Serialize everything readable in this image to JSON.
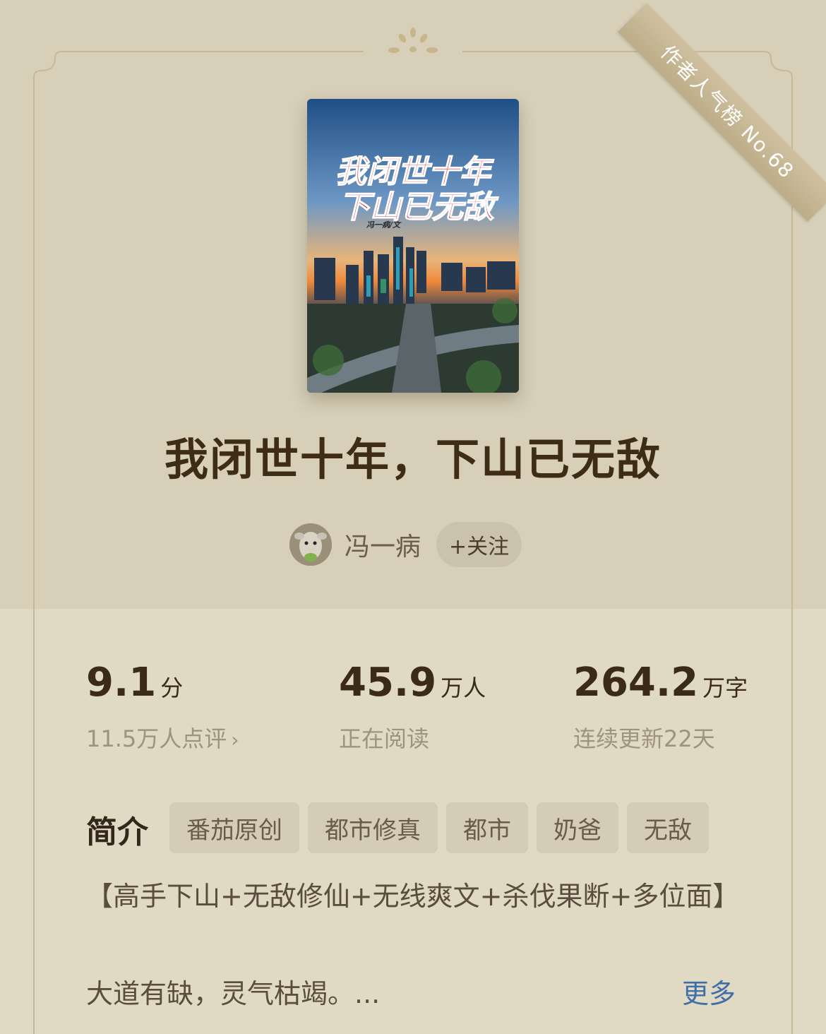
{
  "badge": {
    "label": "作者人气榜",
    "rank": "No.68"
  },
  "book": {
    "title": "我闭世十年，下山已无敌",
    "cover": {
      "title_line1": "我闭世十年",
      "title_line2": "下山已无敌",
      "byline": "冯一病/文"
    }
  },
  "author": {
    "name": "冯一病",
    "follow_label": "+关注"
  },
  "stats": [
    {
      "value": "9.1",
      "unit": "分",
      "sub": "11.5万人点评",
      "chevron": "›"
    },
    {
      "value": "45.9",
      "unit": "万人",
      "sub": "正在阅读"
    },
    {
      "value": "264.2",
      "unit": "万字",
      "sub": "连续更新22天"
    }
  ],
  "intro": {
    "label": "简介",
    "tags": [
      "番茄原创",
      "都市修真",
      "都市",
      "奶爸",
      "无敌"
    ],
    "text_line1": "【高手下山+无敌修仙+无线爽文+杀伐果断+多位面】",
    "text_line2": "大道有缺，灵气枯竭。...",
    "more_label": "更多"
  },
  "colors": {
    "background": "#ddd5c0",
    "title": "#3f2c17",
    "link": "#3f6ea8",
    "tag_bg": "#d4ccb6",
    "ribbon": "#c6b893"
  }
}
